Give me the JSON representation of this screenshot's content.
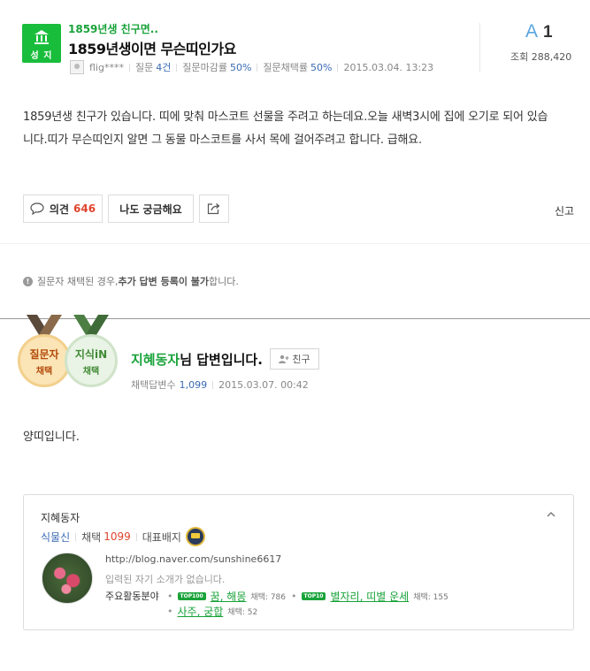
{
  "question": {
    "category_badge": "성 지",
    "breadcrumb": "1859년생 친구면..",
    "title": "1859년생이면 무슨띠인가요",
    "author": "flig****",
    "question_label": "질문",
    "question_count": "4건",
    "deadline_label": "질문마감률",
    "deadline_rate": "50%",
    "adopt_label": "질문채택률",
    "adopt_rate": "50%",
    "date": "2015.03.04. 13:23",
    "answer_letter": "A",
    "answer_count": "1",
    "views_label": "조회",
    "views": "288,420",
    "body": "1859년생 친구가 있습니다. 띠에 맞춰 마스코트 선물을 주려고 하는데요.오늘 새벽3시에 집에 오기로 되어 있습니다.띠가 무슨띠인지 알면 그 동물 마스코트를 사서 목에 걸어주려고 합니다. 급해요."
  },
  "actions": {
    "opinion_label": "의견",
    "opinion_count": "646",
    "curious_label": "나도 궁금해요",
    "report_label": "신고"
  },
  "notice": {
    "pre": "질문자 채택된 경우, ",
    "bold": "추가 답변 등록이 불가",
    "post": "합니다."
  },
  "answer": {
    "medal1_top": "질문자",
    "medal1_bottom": "채택",
    "medal2_top": "지식iN",
    "medal2_bottom": "채택",
    "answerer": "지혜동자",
    "title_suffix": "님 답변입니다.",
    "friend_label": "친구",
    "adopt_label": "채택답변수",
    "adopt_count": "1,099",
    "date": "2015.03.07. 00:42",
    "body": "양띠입니다."
  },
  "profile": {
    "name": "지혜동자",
    "level": "식물신",
    "adopt_label": "채택",
    "adopt_count": "1099",
    "badge_label": "대표배지",
    "blog_url": "http://blog.naver.com/sunshine6617",
    "intro": "입력된 자기 소개가 없습니다.",
    "fields_label": "주요활동분야",
    "fields": [
      {
        "tag": "TOP100",
        "name": "꿈, 해몽",
        "score": "채택: 786"
      },
      {
        "tag": "TOP10",
        "name": "별자리, 띠별 운세",
        "score": "채택: 155"
      },
      {
        "tag": "",
        "name": "사주, 궁합",
        "score": "채택: 52"
      }
    ]
  },
  "colors": {
    "brand_green": "#19bd3c",
    "link_blue": "#3a6bb5",
    "count_red": "#e0452e"
  }
}
